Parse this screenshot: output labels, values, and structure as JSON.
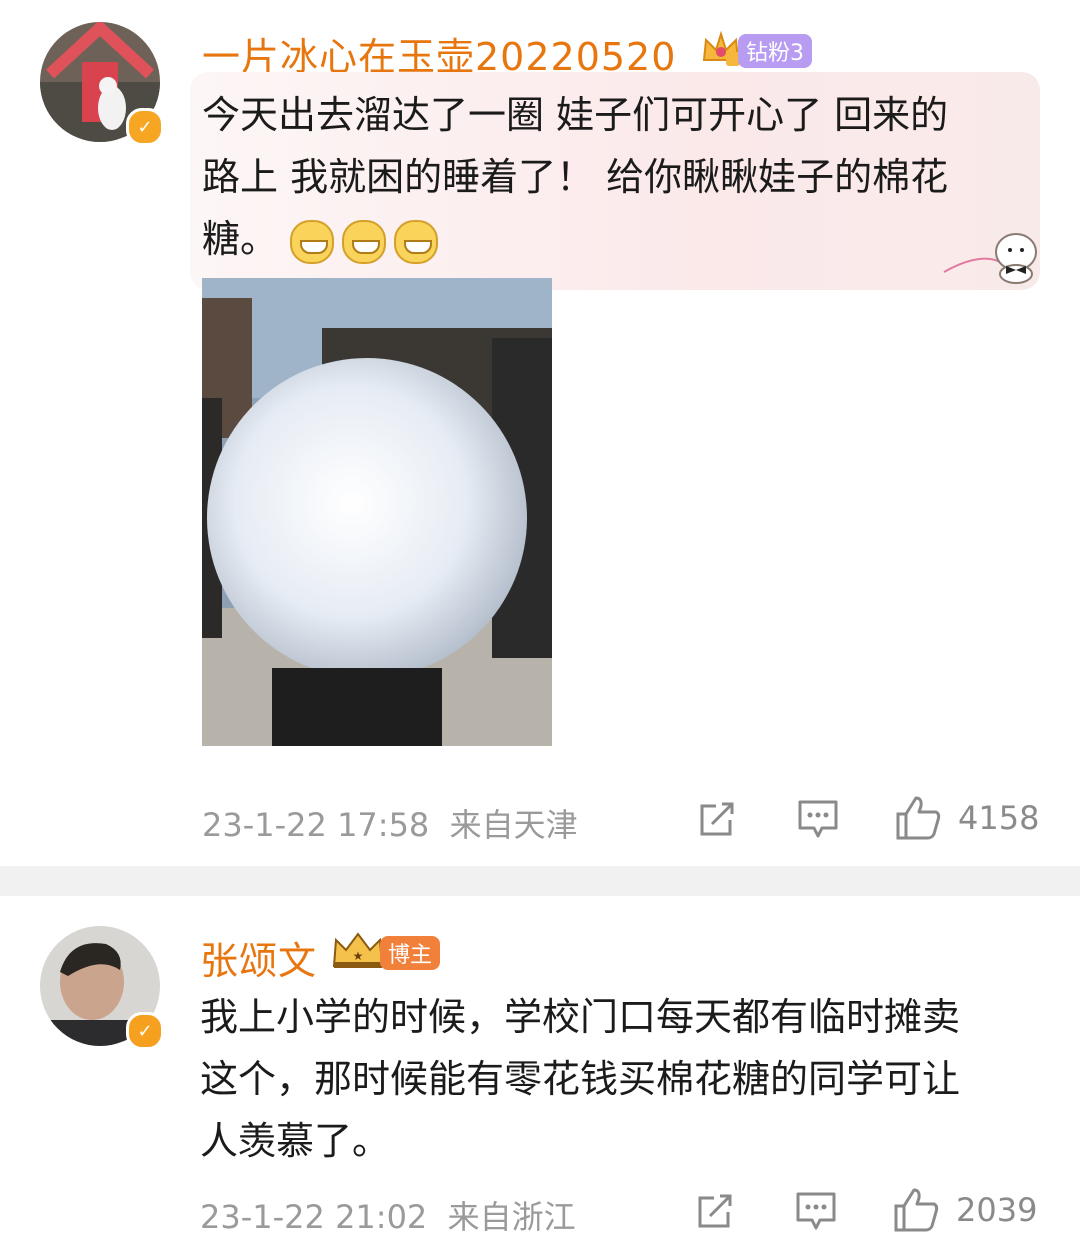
{
  "comments": [
    {
      "username": "一片冰心在玉壶20220520",
      "fan_badge": "钻粉3",
      "text_lines": [
        "今天出去溜达了一圈 娃子们可开心了 回来的",
        "路上 我就困的睡着了！ 给你瞅瞅娃子的棉花",
        "糖。"
      ],
      "emojis": [
        "grin-emoji",
        "grin-emoji",
        "grin-emoji"
      ],
      "time": "23-1-22 17:58",
      "location": "来自天津",
      "likes": "4158",
      "has_image": true
    },
    {
      "username": "张颂文",
      "role_badge": "博主",
      "text_lines": [
        "我上小学的时候，学校门口每天都有临时摊卖",
        "这个，那时候能有零花钱买棉花糖的同学可让",
        "人羡慕了。"
      ],
      "time": "23-1-22 21:02",
      "location": "来自浙江",
      "likes": "2039"
    }
  ],
  "colors": {
    "username": "#e8760e",
    "meta": "#9a9a9a",
    "fan_badge": "#b79cf2",
    "role_badge": "#f0803a",
    "separator": "#f1f1f1"
  }
}
